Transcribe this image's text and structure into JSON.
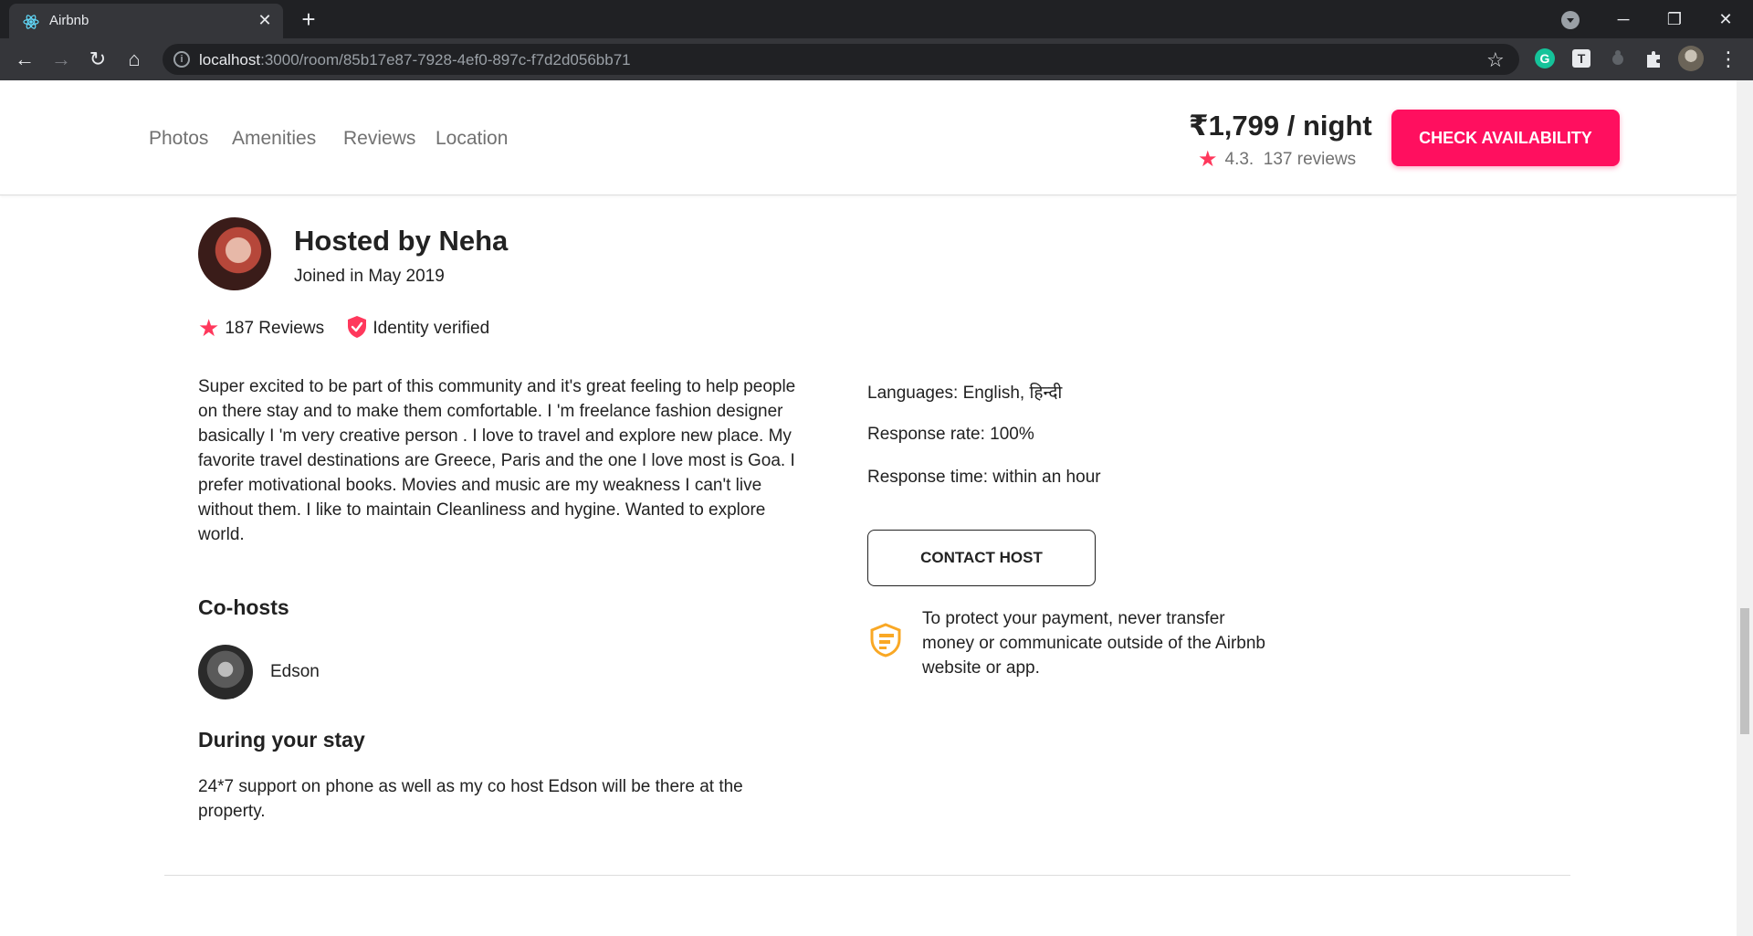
{
  "browser": {
    "tab_title": "Airbnb",
    "url_host": "localhost",
    "url_path": ":3000/room/85b17e87-7928-4ef0-897c-f7d2d056bb71"
  },
  "subnav": {
    "links": [
      "Photos",
      "Amenities",
      "Reviews",
      "Location"
    ],
    "price": "₹1,799 / night",
    "rating": "4.3.",
    "reviews": "137 reviews",
    "cta": "CHECK AVAILABILITY"
  },
  "host": {
    "title": "Hosted by Neha",
    "joined": "Joined in May 2019",
    "reviews": "187 Reviews",
    "identity": "Identity verified",
    "about": "Super excited to be part of this community and it's great feeling to help people on there stay and to make them comfortable. I 'm freelance fashion designer basically I 'm very creative person . I love to travel and explore new place. My favorite travel destinations are Greece, Paris and the one I love most is Goa. I prefer motivational books. Movies and music are my weakness I can't live without them. I like to maintain Cleanliness and hygine. Wanted to explore world.",
    "cohosts_heading": "Co-hosts",
    "cohost_name": "Edson",
    "stay_heading": "During your stay",
    "stay_text": "24*7 support on phone as well as my co host Edson will be there at the property.",
    "languages": "Languages: English, हिन्दी",
    "response_rate": "Response rate: 100%",
    "response_time": "Response time: within an hour",
    "contact": "CONTACT HOST",
    "protect": "To protect your payment, never transfer money or communicate outside of the Airbnb website or app."
  },
  "colors": {
    "brand": "#ff0f5f",
    "star": "#ff385c",
    "shield": "#f9a825"
  }
}
